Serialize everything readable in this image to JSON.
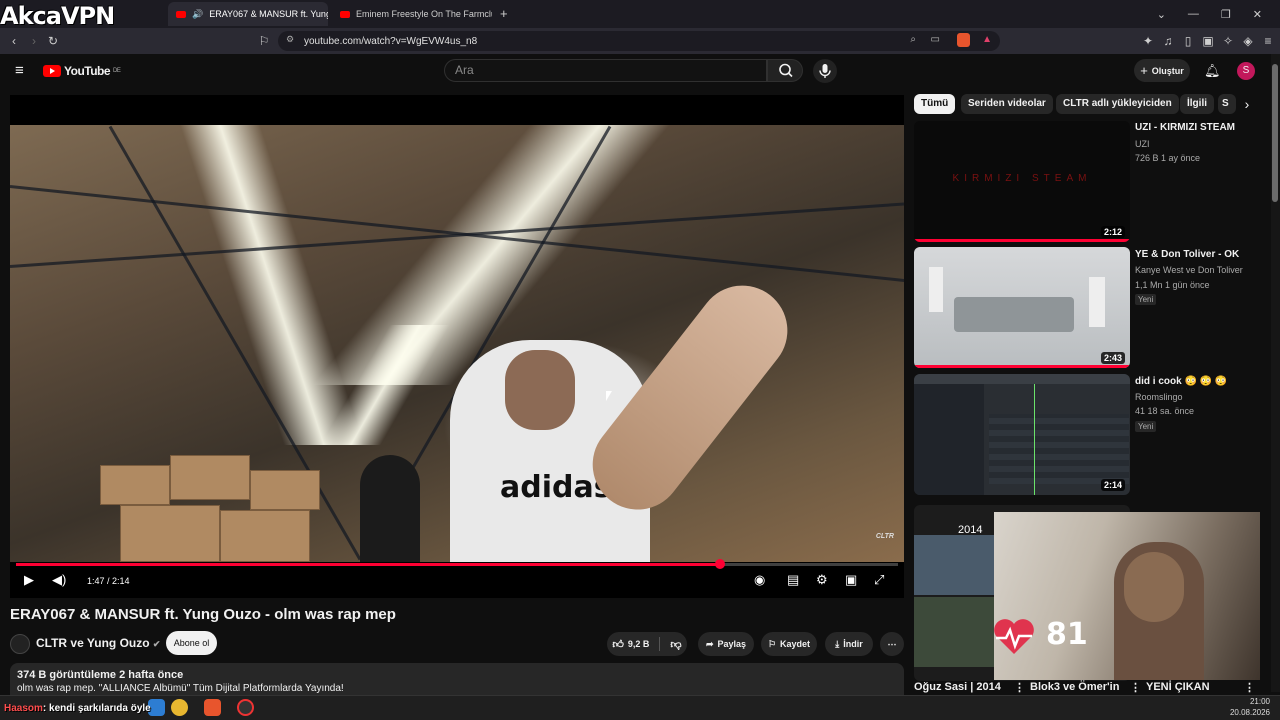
{
  "overlay_brand": "AkcaVPN",
  "browser": {
    "tabs": [
      {
        "label": "ERAY067 & MANSUR ft. Yung",
        "active": true
      },
      {
        "label": "Eminem Freestyle On The Farmclub (",
        "active": false
      }
    ],
    "url": "youtube.com/watch?v=WgEVW4us_n8"
  },
  "header": {
    "logo_text": "YouTube",
    "region": "DE",
    "search_placeholder": "Ara",
    "create_label": "Oluştur",
    "avatar_letter": "S"
  },
  "player": {
    "time": "1:47 / 2:14",
    "progress": 0.798,
    "watermark": "CLTR"
  },
  "video": {
    "title": "ERAY067 & MANSUR ft. Yung Ouzo - olm was rap mep",
    "channel": "CLTR ve Yung Ouzo",
    "subscribe_label": "Abone ol",
    "likes": "9,2 B",
    "share_label": "Paylaş",
    "save_label": "Kaydet",
    "download_label": "İndir",
    "views_meta": "374 B görüntüleme  2 hafta önce",
    "description_line": "olm was rap mep. \"ALLIANCE Albümü\" Tüm Dijital Platformlarda Yayında!"
  },
  "chips": [
    "Tümü",
    "Seriden videolar",
    "CLTR adlı yükleyiciden",
    "İlgili",
    "S"
  ],
  "recommendations": [
    {
      "title": "UZI - KIRMIZI STEAM",
      "channel": "UZI",
      "meta": "726 B  1 ay önce",
      "duration": "2:12",
      "thumb_text": "KIRMIZI STEAM",
      "new": "",
      "watched": 1.0
    },
    {
      "title": "YE & Don Toliver - OK",
      "channel": "Kanye West  ve Don Toliver",
      "meta": "1,1 Mn  1 gün önce",
      "duration": "2:43",
      "thumb_text": "",
      "new": "Yeni",
      "watched": 1.0
    },
    {
      "title": "did i cook 😳 😳 😳",
      "channel": "Roomslingo",
      "meta": "41  18 sa. önce",
      "duration": "2:14",
      "thumb_text": "",
      "new": "Yeni",
      "watched": 0
    }
  ],
  "webcam": {
    "year": "2014",
    "heart_rate": "81",
    "bottom_titles": [
      "Oğuz Sasi | 2014",
      "Blok3 ve Ömer'in",
      "YENİ ÇIKAN"
    ]
  },
  "taskbar": {
    "chat_user": "Haasom",
    "chat_text": ": kendi şarkılarıda öyle",
    "clock_time": "21:00",
    "clock_date": "20.08.2026"
  },
  "colors": {
    "accent": "#ff0033",
    "background": "#0f0f0f",
    "chip_bg": "#272727"
  }
}
